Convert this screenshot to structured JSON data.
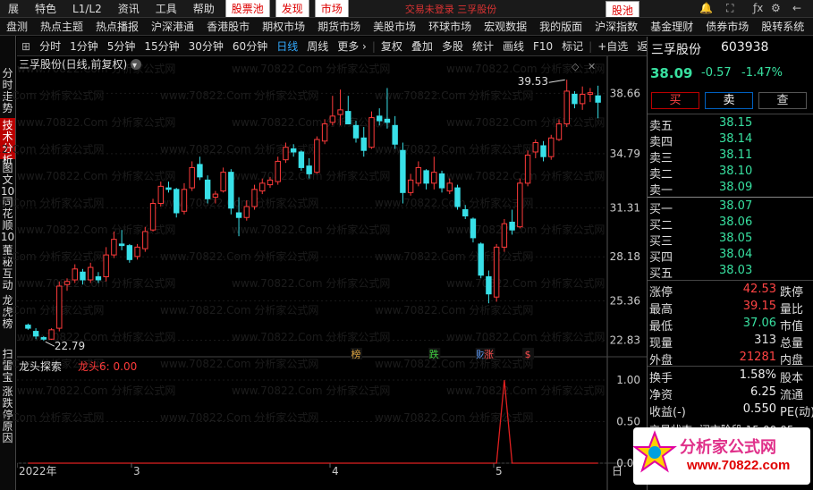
{
  "topbar": {
    "items": [
      "展",
      "特色",
      "L1/L2",
      "资讯",
      "工具",
      "帮助"
    ],
    "stock_pool": "股票池",
    "discover": "发现",
    "market": "市场",
    "title_text": "交易未登录 三孚股份",
    "right_pool": "股池"
  },
  "navbar": {
    "items": [
      "盘测",
      "热点主题",
      "热点播报",
      "沪深港通",
      "香港股市",
      "期权市场",
      "期货市场",
      "美股市场",
      "环球市场",
      "宏观数据",
      "我的版面",
      "沪深指数",
      "基金理财",
      "债券市场",
      "股转系统"
    ],
    "active_index": 0
  },
  "sidebar": {
    "tabs": [
      "分时走势",
      "技术分析",
      "图文10",
      "同花顺10",
      "董秘互动",
      "龙虎榜",
      "扫雷宝",
      "涨跌停原因"
    ],
    "active_index": 1
  },
  "toolbar": {
    "items": [
      "分时",
      "1分钟",
      "5分钟",
      "15分钟",
      "30分钟",
      "60分钟",
      "日线",
      "周线",
      "更多 ›",
      "复权",
      "叠加",
      "多股",
      "统计",
      "画线",
      "F10",
      "标记",
      "+自选",
      "返回"
    ],
    "active_index": 6
  },
  "chart": {
    "title": "三孚股份(日线,前复权)",
    "high_label": "39.53",
    "low_label": "22.79",
    "price_ticks": [
      "38.66",
      "34.79",
      "31.31",
      "28.18",
      "25.36",
      "22.83"
    ],
    "indicator_name": "龙头探索",
    "indicator_value": "龙头6: 0.00",
    "indicator_ticks": [
      "1.00",
      "0.50",
      "0.00"
    ],
    "x_labels": [
      "2022年",
      "3",
      "4",
      "5"
    ],
    "date_hint": "日",
    "markers": [
      {
        "text": "榜",
        "color": "#d8a040"
      },
      {
        "text": "跌",
        "color": "#40d040"
      },
      {
        "text": "财",
        "color": "#60a0ff"
      },
      {
        "text": "涨",
        "color": "#ff5050"
      },
      {
        "text": "$",
        "color": "#ff5050"
      }
    ],
    "up_color": "#ff3b3b",
    "down_color": "#38e0e8",
    "indicator_color": "#e02020"
  },
  "chart_data": {
    "type": "candlestick",
    "title": "三孚股份(日线,前复权)",
    "ylim": [
      22.0,
      40.0
    ],
    "candles": [
      {
        "o": 23.8,
        "h": 23.9,
        "l": 23.5,
        "c": 23.6
      },
      {
        "o": 23.4,
        "h": 23.6,
        "l": 22.9,
        "c": 23.1
      },
      {
        "o": 23.0,
        "h": 23.1,
        "l": 22.79,
        "c": 22.9
      },
      {
        "o": 22.9,
        "h": 23.6,
        "l": 22.85,
        "c": 23.5
      },
      {
        "o": 23.6,
        "h": 26.6,
        "l": 23.4,
        "c": 26.3
      },
      {
        "o": 26.4,
        "h": 26.8,
        "l": 26.0,
        "c": 26.6
      },
      {
        "o": 26.7,
        "h": 27.7,
        "l": 26.5,
        "c": 27.4
      },
      {
        "o": 27.2,
        "h": 27.4,
        "l": 26.4,
        "c": 26.7
      },
      {
        "o": 26.7,
        "h": 27.8,
        "l": 26.5,
        "c": 27.5
      },
      {
        "o": 26.9,
        "h": 27.2,
        "l": 26.5,
        "c": 26.7
      },
      {
        "o": 26.9,
        "h": 28.8,
        "l": 26.6,
        "c": 28.3
      },
      {
        "o": 28.3,
        "h": 29.8,
        "l": 28.1,
        "c": 29.3
      },
      {
        "o": 29.0,
        "h": 29.9,
        "l": 28.6,
        "c": 28.9
      },
      {
        "o": 28.9,
        "h": 29.0,
        "l": 27.8,
        "c": 28.0
      },
      {
        "o": 28.2,
        "h": 29.0,
        "l": 28.0,
        "c": 28.8
      },
      {
        "o": 28.7,
        "h": 30.1,
        "l": 28.5,
        "c": 29.8
      },
      {
        "o": 29.9,
        "h": 31.9,
        "l": 29.8,
        "c": 31.6
      },
      {
        "o": 31.6,
        "h": 33.0,
        "l": 31.4,
        "c": 32.7
      },
      {
        "o": 32.6,
        "h": 33.0,
        "l": 32.3,
        "c": 32.5
      },
      {
        "o": 32.5,
        "h": 32.6,
        "l": 30.7,
        "c": 31.0
      },
      {
        "o": 31.1,
        "h": 32.9,
        "l": 30.9,
        "c": 32.5
      },
      {
        "o": 32.6,
        "h": 34.3,
        "l": 32.4,
        "c": 33.9
      },
      {
        "o": 34.1,
        "h": 34.6,
        "l": 33.1,
        "c": 33.3
      },
      {
        "o": 33.1,
        "h": 33.4,
        "l": 31.6,
        "c": 31.9
      },
      {
        "o": 32.0,
        "h": 32.4,
        "l": 31.6,
        "c": 32.2
      },
      {
        "o": 32.4,
        "h": 33.9,
        "l": 32.3,
        "c": 33.6
      },
      {
        "o": 33.6,
        "h": 33.8,
        "l": 30.9,
        "c": 31.3
      },
      {
        "o": 31.0,
        "h": 32.0,
        "l": 29.5,
        "c": 30.7
      },
      {
        "o": 30.7,
        "h": 31.8,
        "l": 30.5,
        "c": 31.4
      },
      {
        "o": 31.4,
        "h": 32.8,
        "l": 31.2,
        "c": 32.5
      },
      {
        "o": 32.4,
        "h": 33.2,
        "l": 32.2,
        "c": 32.9
      },
      {
        "o": 32.8,
        "h": 33.3,
        "l": 32.6,
        "c": 33.1
      },
      {
        "o": 33.0,
        "h": 34.6,
        "l": 32.8,
        "c": 34.3
      },
      {
        "o": 34.4,
        "h": 35.5,
        "l": 34.2,
        "c": 35.2
      },
      {
        "o": 35.1,
        "h": 35.4,
        "l": 34.6,
        "c": 34.9
      },
      {
        "o": 34.9,
        "h": 35.0,
        "l": 33.7,
        "c": 33.9
      },
      {
        "o": 34.0,
        "h": 34.5,
        "l": 33.2,
        "c": 33.5
      },
      {
        "o": 33.6,
        "h": 35.9,
        "l": 33.5,
        "c": 35.7
      },
      {
        "o": 35.6,
        "h": 37.0,
        "l": 35.4,
        "c": 36.7
      },
      {
        "o": 36.8,
        "h": 38.5,
        "l": 36.6,
        "c": 37.2
      },
      {
        "o": 37.3,
        "h": 38.9,
        "l": 36.6,
        "c": 37.6
      },
      {
        "o": 37.5,
        "h": 38.5,
        "l": 36.9,
        "c": 36.7
      },
      {
        "o": 36.6,
        "h": 36.9,
        "l": 35.5,
        "c": 35.8
      },
      {
        "o": 35.8,
        "h": 36.5,
        "l": 34.6,
        "c": 35.0
      },
      {
        "o": 35.2,
        "h": 37.5,
        "l": 35.1,
        "c": 37.1
      },
      {
        "o": 37.2,
        "h": 37.7,
        "l": 36.6,
        "c": 36.9
      },
      {
        "o": 37.0,
        "h": 39.0,
        "l": 36.4,
        "c": 36.8
      },
      {
        "o": 36.6,
        "h": 37.2,
        "l": 35.1,
        "c": 35.4
      },
      {
        "o": 35.0,
        "h": 35.5,
        "l": 31.6,
        "c": 32.3
      },
      {
        "o": 32.3,
        "h": 33.5,
        "l": 32.1,
        "c": 33.1
      },
      {
        "o": 32.9,
        "h": 34.3,
        "l": 32.7,
        "c": 33.9
      },
      {
        "o": 33.7,
        "h": 33.8,
        "l": 32.5,
        "c": 32.9
      },
      {
        "o": 32.9,
        "h": 34.6,
        "l": 32.5,
        "c": 33.6
      },
      {
        "o": 33.5,
        "h": 33.7,
        "l": 32.3,
        "c": 32.6
      },
      {
        "o": 32.4,
        "h": 33.2,
        "l": 32.2,
        "c": 32.9
      },
      {
        "o": 32.6,
        "h": 32.8,
        "l": 31.2,
        "c": 31.4
      },
      {
        "o": 31.2,
        "h": 31.5,
        "l": 30.6,
        "c": 30.8
      },
      {
        "o": 30.6,
        "h": 30.7,
        "l": 29.1,
        "c": 29.4
      },
      {
        "o": 29.0,
        "h": 29.1,
        "l": 26.8,
        "c": 27.0
      },
      {
        "o": 26.9,
        "h": 27.3,
        "l": 25.2,
        "c": 25.8
      },
      {
        "o": 25.6,
        "h": 29.0,
        "l": 25.3,
        "c": 28.8
      },
      {
        "o": 28.8,
        "h": 30.6,
        "l": 28.5,
        "c": 30.3
      },
      {
        "o": 30.4,
        "h": 31.2,
        "l": 29.6,
        "c": 29.9
      },
      {
        "o": 30.1,
        "h": 33.2,
        "l": 30.0,
        "c": 32.9
      },
      {
        "o": 32.9,
        "h": 35.0,
        "l": 32.7,
        "c": 34.7
      },
      {
        "o": 34.9,
        "h": 35.7,
        "l": 34.5,
        "c": 35.5
      },
      {
        "o": 35.3,
        "h": 35.6,
        "l": 34.3,
        "c": 34.6
      },
      {
        "o": 34.6,
        "h": 36.0,
        "l": 34.4,
        "c": 35.8
      },
      {
        "o": 35.7,
        "h": 37.0,
        "l": 35.6,
        "c": 36.7
      },
      {
        "o": 36.7,
        "h": 39.53,
        "l": 36.5,
        "c": 38.8
      },
      {
        "o": 38.6,
        "h": 38.8,
        "l": 37.7,
        "c": 38.0
      },
      {
        "o": 38.0,
        "h": 39.1,
        "l": 37.6,
        "c": 38.6
      },
      {
        "o": 38.6,
        "h": 39.0,
        "l": 38.1,
        "c": 38.7
      },
      {
        "o": 38.5,
        "h": 39.15,
        "l": 37.06,
        "c": 38.09
      }
    ],
    "indicator": {
      "name": "龙头探索",
      "spike_index": 61,
      "spike_value": 1.0
    }
  },
  "quote": {
    "name": "三孚股份",
    "code": "603938",
    "price": "38.09",
    "change": "-0.57",
    "change_pct": "-1.47%",
    "buy_btn": "买",
    "sell_btn": "卖",
    "check_btn": "查",
    "asks": [
      {
        "label": "卖五",
        "price": "38.15"
      },
      {
        "label": "卖四",
        "price": "38.14"
      },
      {
        "label": "卖三",
        "price": "38.11"
      },
      {
        "label": "卖二",
        "price": "38.10"
      },
      {
        "label": "卖一",
        "price": "38.09"
      }
    ],
    "bids": [
      {
        "label": "买一",
        "price": "38.07"
      },
      {
        "label": "买二",
        "price": "38.06"
      },
      {
        "label": "买三",
        "price": "38.05"
      },
      {
        "label": "买四",
        "price": "38.04"
      },
      {
        "label": "买五",
        "price": "38.03"
      }
    ],
    "stats": [
      {
        "l": "涨停",
        "v": "42.53",
        "r": "跌停",
        "c": "#ff4444"
      },
      {
        "l": "最高",
        "v": "39.15",
        "r": "量比",
        "c": "#ff4444"
      },
      {
        "l": "最低",
        "v": "37.06",
        "r": "市值",
        "c": "#38e0a0"
      },
      {
        "l": "现量",
        "v": "313",
        "r": "总量",
        "c": "#e0e0e0"
      },
      {
        "l": "外盘",
        "v": "21281",
        "r": "内盘",
        "c": "#ff4444"
      }
    ],
    "stats2": [
      {
        "l": "换手",
        "v": "1.58%",
        "r": "股本"
      },
      {
        "l": "净资",
        "v": "6.25",
        "r": "流通"
      },
      {
        "l": "收益(-)",
        "v": "0.550",
        "r": "PE(动)"
      }
    ],
    "partial_row": "交易状态: 闭市阶段 15:00:05"
  },
  "watermark": "www.70822.Com 分析家公式网",
  "logo": {
    "text": "分析家公式网",
    "url": "www.70822.com"
  }
}
